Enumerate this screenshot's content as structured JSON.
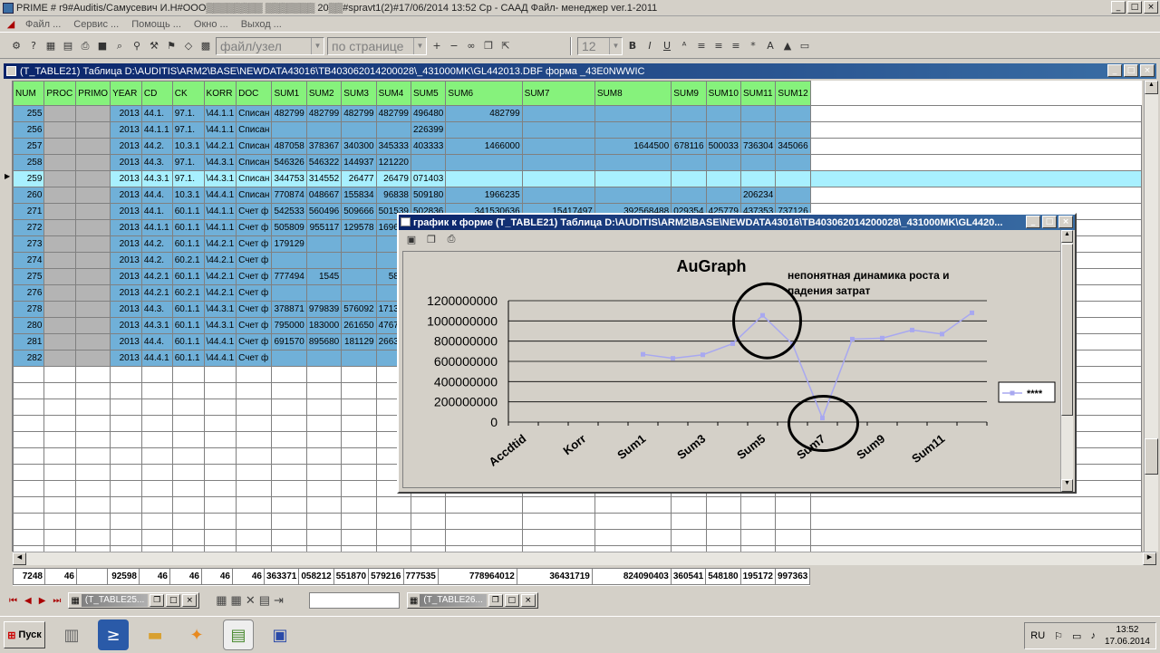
{
  "window": {
    "title": "PRIME # r9#Auditis/Самусевич И.Н#OOO▒▒▒▒▒▒▒▒ ▒▒▒▒▒▒▒ 20▒▒#spravt1(2)#17/06/2014 13:52 Ср - CAAД Файл- менеджер ver.1-2011"
  },
  "menu": [
    "Файл ...",
    "Сервис ...",
    "Помощь ...",
    "Окно ...",
    "Выход ..."
  ],
  "toolbar": {
    "combo1": "файл/узел",
    "combo2": "по странице",
    "font_size": "12",
    "bold": "B",
    "italic": "I",
    "underline": "U"
  },
  "child": {
    "title": "(T_TABLE21)  Таблица D:\\AUDITIS\\ARM2\\BASE\\NEWDATA43016\\TB403062014200028\\_431000MK\\GL442013.DBF форма _43E0NWWIC"
  },
  "table": {
    "columns": [
      "NUM",
      "PROC",
      "PRIMO",
      "YEAR",
      "CD",
      "CK",
      "KORR",
      "DOC",
      "SUM1",
      "SUM2",
      "SUM3",
      "SUM4",
      "SUM5",
      "SUM6",
      "SUM7",
      "SUM8",
      "SUM9",
      "SUM10",
      "SUM11",
      "SUM12"
    ],
    "rows": [
      [
        "255",
        "",
        "",
        "2013",
        "44.1.",
        "97.1.",
        "\\44.1.1",
        "Списан",
        "482799",
        "482799",
        "482799",
        "482799",
        "496480",
        "482799",
        "",
        "",
        "",
        "",
        "",
        ""
      ],
      [
        "256",
        "",
        "",
        "2013",
        "44.1.1",
        "97.1.",
        "\\44.1.1",
        "Списан",
        "",
        "",
        "",
        "",
        "226399",
        "",
        "",
        "",
        "",
        "",
        "",
        ""
      ],
      [
        "257",
        "",
        "",
        "2013",
        "44.2.",
        "10.3.1",
        "\\44.2.1",
        "Списан",
        "487058",
        "378367",
        "340300",
        "345333",
        "403333",
        "1466000",
        "",
        "1644500",
        "678116",
        "500033",
        "736304",
        "345066"
      ],
      [
        "258",
        "",
        "",
        "2013",
        "44.3.",
        "97.1.",
        "\\44.3.1",
        "Списан",
        "546326",
        "546322",
        "144937",
        "121220",
        "",
        "",
        "",
        "",
        "",
        "",
        "",
        ""
      ],
      [
        "259",
        "",
        "",
        "2013",
        "44.3.1",
        "97.1.",
        "\\44.3.1",
        "Списан",
        "344753",
        "314552",
        "26477",
        "26479",
        "071403",
        "",
        "",
        "",
        "",
        "",
        "",
        ""
      ],
      [
        "260",
        "",
        "",
        "2013",
        "44.4.",
        "10.3.1",
        "\\44.4.1",
        "Списан",
        "770874",
        "048667",
        "155834",
        "96838",
        "509180",
        "1966235",
        "",
        "",
        "",
        "",
        "206234",
        ""
      ],
      [
        "271",
        "",
        "",
        "2013",
        "44.1.",
        "60.1.1",
        "\\44.1.1",
        "Счет ф",
        "542533",
        "560496",
        "509666",
        "501539",
        "502836",
        "341530636",
        "15417497",
        "392568488",
        "029354",
        "425779",
        "437353",
        "737126"
      ],
      [
        "272",
        "",
        "",
        "2013",
        "44.1.1",
        "60.1.1",
        "\\44.1.1",
        "Счет ф",
        "505809",
        "955117",
        "129578",
        "169638",
        "",
        "",
        "",
        "",
        "",
        "",
        "",
        ""
      ],
      [
        "273",
        "",
        "",
        "2013",
        "44.2.",
        "60.1.1",
        "\\44.2.1",
        "Счет ф",
        "179129",
        "",
        "",
        "",
        "",
        "",
        "",
        "",
        "",
        "",
        "",
        ""
      ],
      [
        "274",
        "",
        "",
        "2013",
        "44.2.",
        "60.2.1",
        "\\44.2.1",
        "Счет ф",
        "",
        "",
        "",
        "",
        "",
        "",
        "",
        "",
        "",
        "",
        "",
        ""
      ],
      [
        "275",
        "",
        "",
        "2013",
        "44.2.1",
        "60.1.1",
        "\\44.2.1",
        "Счет ф",
        "777494",
        "1545",
        "",
        "5864",
        "",
        "",
        "",
        "",
        "",
        "",
        "",
        ""
      ],
      [
        "276",
        "",
        "",
        "2013",
        "44.2.1",
        "60.2.1",
        "\\44.2.1",
        "Счет ф",
        "",
        "",
        "",
        "",
        "",
        "",
        "",
        "",
        "",
        "",
        "",
        ""
      ],
      [
        "278",
        "",
        "",
        "2013",
        "44.3.",
        "60.1.1",
        "\\44.3.1",
        "Счет ф",
        "378871",
        "979839",
        "576092",
        "171376",
        "",
        "",
        "",
        "",
        "",
        "",
        "",
        ""
      ],
      [
        "280",
        "",
        "",
        "2013",
        "44.3.1",
        "60.1.1",
        "\\44.3.1",
        "Счет ф",
        "795000",
        "183000",
        "261650",
        "476755",
        "",
        "",
        "",
        "",
        "",
        "",
        "",
        ""
      ],
      [
        "281",
        "",
        "",
        "2013",
        "44.4.",
        "60.1.1",
        "\\44.4.1",
        "Счет ф",
        "691570",
        "895680",
        "181129",
        "266352",
        "",
        "",
        "",
        "",
        "",
        "",
        "",
        ""
      ],
      [
        "282",
        "",
        "",
        "2013",
        "44.4.1",
        "60.1.1",
        "\\44.4.1",
        "Счет ф",
        "",
        "",
        "",
        "",
        "",
        "",
        "",
        "",
        "",
        "",
        "",
        ""
      ]
    ],
    "totals": [
      "7248",
      "46",
      "",
      "92598",
      "46",
      "46",
      "46",
      "46",
      "363371",
      "058212",
      "551870",
      "579216",
      "777535",
      "778964012",
      "36431719",
      "824090403",
      "360541",
      "548180",
      "195172",
      "997363"
    ]
  },
  "minis": [
    {
      "label": "(T_TABLE25..."
    },
    {
      "label": "(T_TABLE26..."
    }
  ],
  "graph": {
    "title": "график к форме (T_TABLE21)  Таблица D:\\AUDITIS\\ARM2\\BASE\\NEWDATA43016\\TB403062014200028\\_431000MK\\GL4420..."
  },
  "chart_data": {
    "type": "line",
    "title": "AuGraph",
    "annotation": "непонятная динамика роста и падения затрат",
    "categories": [
      "Accdtid",
      "",
      "Korr",
      "",
      "Sum1",
      "",
      "Sum3",
      "",
      "Sum5",
      "",
      "Sum7",
      "",
      "Sum9",
      "",
      "Sum11",
      ""
    ],
    "tick_labels": [
      "Accdtid",
      "Korr",
      "Sum1",
      "Sum3",
      "Sum5",
      "Sum7",
      "Sum9",
      "Sum11"
    ],
    "series": [
      {
        "name": "****",
        "values": [
          null,
          null,
          null,
          null,
          670000000,
          630000000,
          665000000,
          775000000,
          1055000000,
          770000000,
          40000000,
          820000000,
          830000000,
          910000000,
          870000000,
          1080000000
        ]
      }
    ],
    "yticks": [
      "0",
      "200000000",
      "400000000",
      "600000000",
      "800000000",
      "1000000000",
      "1200000000"
    ],
    "ylim": [
      0,
      1200000000
    ],
    "color": "#a8a8f0"
  },
  "taskbar": {
    "start": "Пуск",
    "lang": "RU",
    "time": "13:52",
    "date": "17.06.2014"
  }
}
